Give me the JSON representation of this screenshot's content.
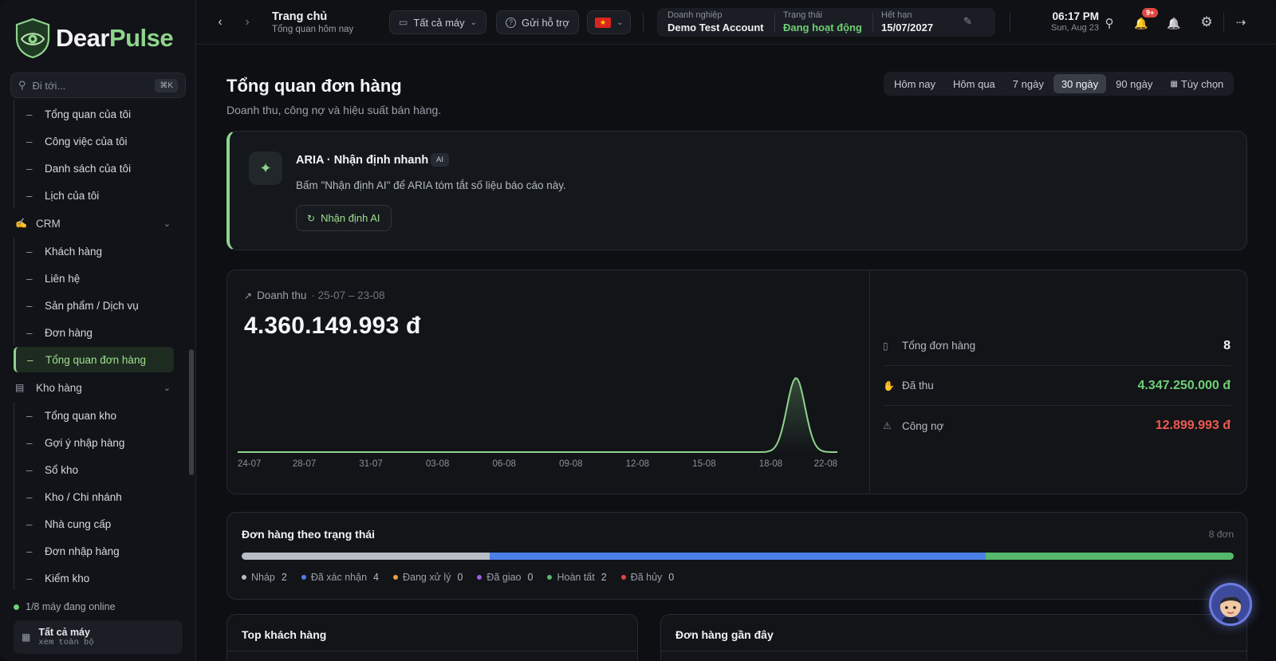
{
  "brand": {
    "name_part1": "Dear",
    "name_part2": "Pulse"
  },
  "sidebar": {
    "search_placeholder": "Đi tới...",
    "search_shortcut": "⌘K",
    "personal_items": [
      "Tổng quan của tôi",
      "Công việc của tôi",
      "Danh sách của tôi",
      "Lịch của tôi"
    ],
    "crm": {
      "label": "CRM",
      "items": [
        "Khách hàng",
        "Liên hệ",
        "Sản phẩm / Dịch vụ",
        "Đơn hàng",
        "Tổng quan đơn hàng"
      ],
      "active": "Tổng quan đơn hàng"
    },
    "warehouse": {
      "label": "Kho hàng",
      "items": [
        "Tổng quan kho",
        "Gợi ý nhập hàng",
        "Sổ kho",
        "Kho / Chi nhánh",
        "Nhà cung cấp",
        "Đơn nhập hàng",
        "Kiểm kho"
      ]
    },
    "online_status": "1/8 máy đang online",
    "machine": {
      "title": "Tất cả máy",
      "subtitle": "xem toàn bộ"
    }
  },
  "header": {
    "title": "Trang chủ",
    "subtitle": "Tổng quan hôm nay",
    "machine_select": "Tất cả máy",
    "support": "Gửi hỗ trợ",
    "account": {
      "org_label": "Doanh nghiệp",
      "org_value": "Demo Test Account",
      "status_label": "Trạng thái",
      "status_value": "Đang hoạt động",
      "expiry_label": "Hết hạn",
      "expiry_value": "15/07/2027"
    },
    "time": "06:17 PM",
    "date": "Sun, Aug 23",
    "notif_badge": "9+"
  },
  "main": {
    "title": "Tổng quan đơn hàng",
    "subtitle": "Doanh thu, công nợ và hiệu suất bán hàng.",
    "ranges": [
      "Hôm nay",
      "Hôm qua",
      "7 ngày",
      "30 ngày",
      "90 ngày",
      "Tùy chọn"
    ],
    "selected_range": "30 ngày",
    "aria": {
      "title": "ARIA · Nhận định nhanh",
      "tag": "AI",
      "description": "Bấm \"Nhận định AI\" để ARIA tóm tắt số liệu báo cáo này.",
      "button": "Nhận định AI"
    },
    "revenue": {
      "label": "Doanh thu",
      "range": "· 25-07 – 23-08",
      "amount": "4.360.149.993 đ"
    },
    "stats": [
      {
        "label": "Tổng đơn hàng",
        "value": "8",
        "color": "#f2f4f6"
      },
      {
        "label": "Đã thu",
        "value": "4.347.250.000 đ",
        "color": "#6fcf74"
      },
      {
        "label": "Công nợ",
        "value": "12.899.993 đ",
        "color": "#ee5a4f"
      }
    ],
    "status_card": {
      "title": "Đơn hàng theo trạng thái",
      "count": "8 đơn",
      "statuses": [
        {
          "label": "Nháp",
          "count": 2,
          "color": "#b8bcc4"
        },
        {
          "label": "Đã xác nhận",
          "count": 4,
          "color": "#4c7fe6"
        },
        {
          "label": "Đang xử lý",
          "count": 0,
          "color": "#e5a23a"
        },
        {
          "label": "Đã giao",
          "count": 0,
          "color": "#a05be0"
        },
        {
          "label": "Hoàn tất",
          "count": 2,
          "color": "#55b86a"
        },
        {
          "label": "Đã hủy",
          "count": 0,
          "color": "#e0463f"
        }
      ]
    },
    "top_customers": "Top khách hàng",
    "recent_orders": "Đơn hàng gần đây"
  },
  "chart_data": {
    "type": "area",
    "x_ticks": [
      "24-07",
      "28-07",
      "31-07",
      "03-08",
      "06-08",
      "09-08",
      "12-08",
      "15-08",
      "18-08",
      "22-08"
    ],
    "peak_day_offset": 27,
    "days": 30,
    "color": "#8fd48c"
  }
}
